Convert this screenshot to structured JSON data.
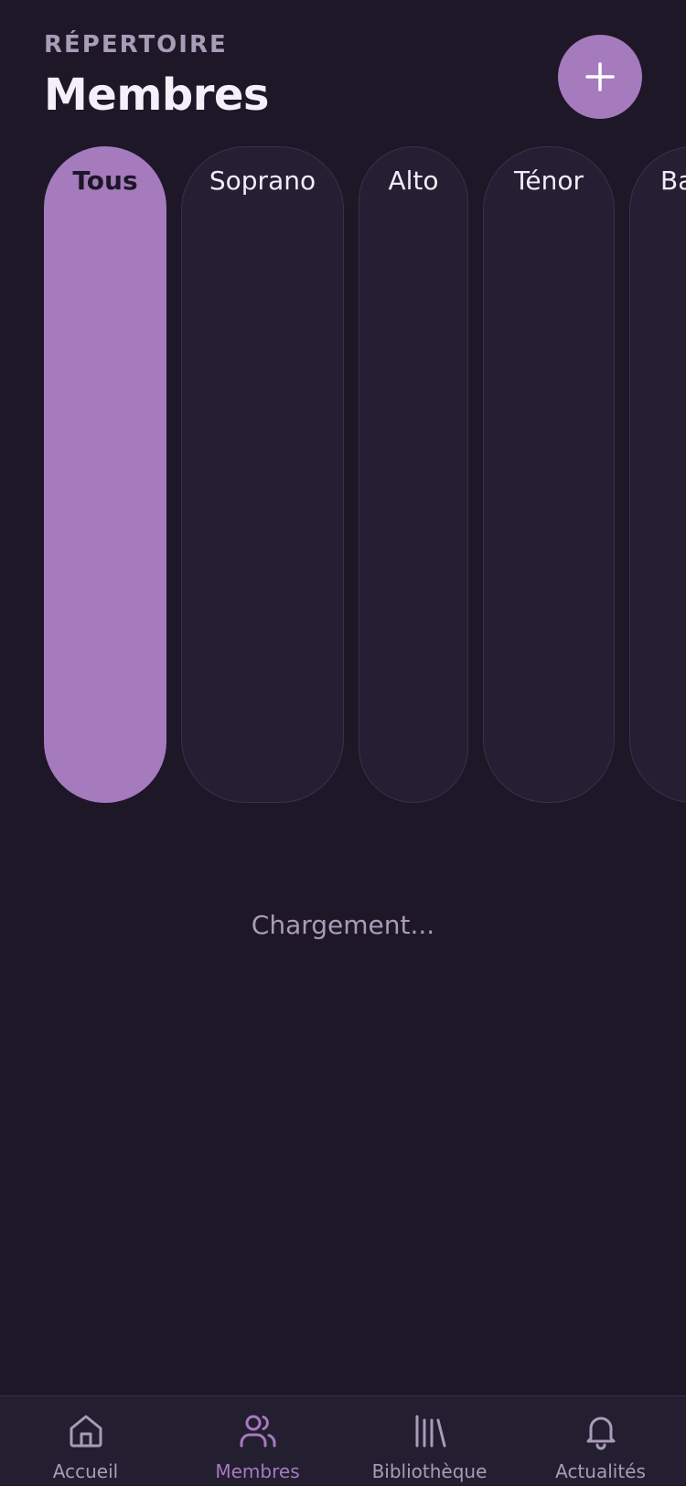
{
  "header": {
    "eyebrow": "RÉPERTOIRE",
    "title": "Membres",
    "add_icon": "plus-icon"
  },
  "filters": [
    {
      "label": "Tous",
      "active": true
    },
    {
      "label": "Soprano",
      "active": false
    },
    {
      "label": "Alto",
      "active": false
    },
    {
      "label": "Ténor",
      "active": false
    },
    {
      "label": "Ba",
      "active": false
    }
  ],
  "status": {
    "loading_text": "Chargement..."
  },
  "bottom_nav": {
    "items": [
      {
        "label": "Accueil",
        "icon": "home-icon",
        "active": false
      },
      {
        "label": "Membres",
        "icon": "users-icon",
        "active": true
      },
      {
        "label": "Bibliothèque",
        "icon": "library-icon",
        "active": false
      },
      {
        "label": "Actualités",
        "icon": "bell-icon",
        "active": false
      }
    ]
  },
  "colors": {
    "background": "#1d1727",
    "accent": "#a57bbd",
    "surface": "#251f33",
    "muted_text": "#a99cb8"
  }
}
